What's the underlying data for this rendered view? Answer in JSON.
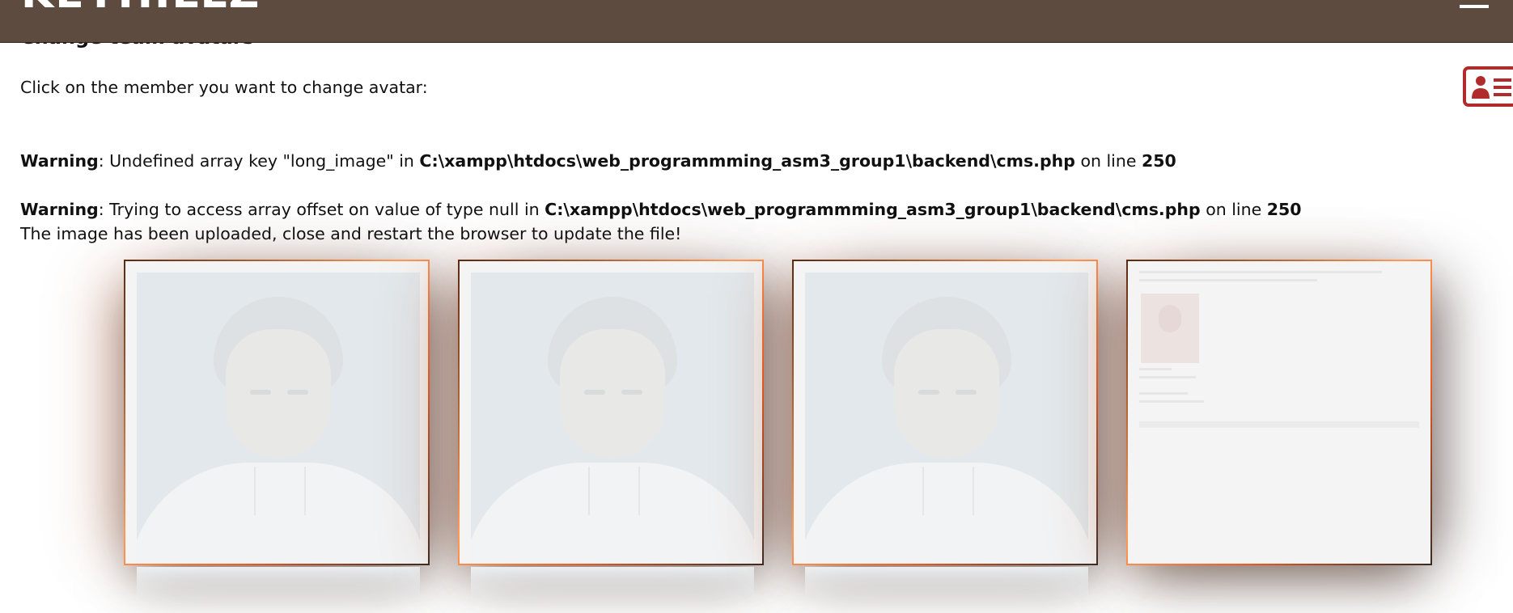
{
  "header": {
    "brand": "KEYHILLZ",
    "menu_icon": "hamburger-menu-icon"
  },
  "page": {
    "title": "Change team avatars",
    "instruction": "Click on the member you want to change avatar:",
    "card_icon": "member-card-icon"
  },
  "warnings": [
    {
      "label": "Warning",
      "message": ": Undefined array key \"long_image\" in ",
      "path": "C:\\xampp\\htdocs\\web_programmming_asm3_group1\\backend\\cms.php",
      "on_line": " on line ",
      "line": "250"
    },
    {
      "label": "Warning",
      "message": ": Trying to access array offset on value of type null in ",
      "path": "C:\\xampp\\htdocs\\web_programmming_asm3_group1\\backend\\cms.php",
      "on_line": " on line ",
      "line": "250"
    }
  ],
  "status_message": "The image has been uploaded, close and restart the browser to update the file!",
  "members": [
    {
      "kind": "portrait"
    },
    {
      "kind": "portrait"
    },
    {
      "kind": "portrait"
    },
    {
      "kind": "screenshot"
    }
  ],
  "colors": {
    "header_bg": "#5c4b3e",
    "icon_red": "#b02b2b",
    "tile_border_accent": "#f05a20"
  }
}
